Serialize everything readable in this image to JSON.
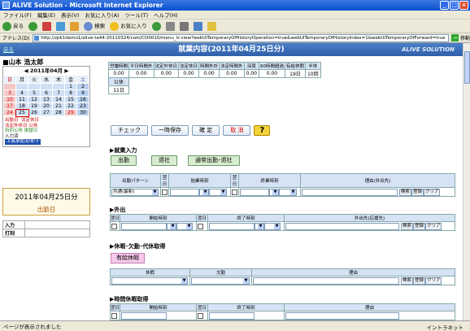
{
  "window": {
    "title": "ALIVE Solution - Microsoft Internet Explorer"
  },
  "menu": [
    "ファイル(F)",
    "編集(E)",
    "表示(V)",
    "お気に入り(A)",
    "ツール(T)",
    "ヘルプ(H)"
  ],
  "toolbar": {
    "back": "戻る",
    "search": "検索",
    "favorites": "お気に入り"
  },
  "address": {
    "label": "アドレス(D)",
    "url": "http://zpk1demo1/alive-ta44-20110324/com/CO0010/menu_tr.view?webUITemporaryOfHistoryOperation=true&webUITemporaryOfHistoryIndex=1&webUITemporaryOfForward=true",
    "go_label": "移動"
  },
  "header": {
    "back_link": "戻る",
    "title": "就業内容(2011年04月25日分)",
    "logo": "ALIVE SOLUTION"
  },
  "user": {
    "name": "山本 浩太郎"
  },
  "calendar": {
    "month": "2011年04月",
    "weekdays": [
      "日",
      "月",
      "火",
      "水",
      "木",
      "金",
      "土"
    ],
    "weeks": [
      [
        "",
        "",
        "",
        "",
        "",
        "1",
        "2"
      ],
      [
        "3",
        "4",
        "5",
        "6",
        "7",
        "8",
        "9"
      ],
      [
        "10",
        "11",
        "12",
        "13",
        "14",
        "15",
        "16"
      ],
      [
        "17",
        "18",
        "19",
        "20",
        "21",
        "22",
        "23"
      ],
      [
        "24",
        "25",
        "26",
        "27",
        "28",
        "29",
        "30"
      ]
    ],
    "legend_l1a": "出勤日",
    "legend_l1b": "法定休日",
    "legend_l2": "法定外休日 公休",
    "legend_l3": "特別公休 振替日",
    "legend_l4": "入力済",
    "legend_badge": "上長承認済/却下"
  },
  "current": {
    "date": "2011年04月25日分",
    "type": "出勤日"
  },
  "inout": {
    "in_label": "入力",
    "out_label": "打刻"
  },
  "summary": {
    "headers": [
      "労働時間",
      "平日時間外",
      "法定外休日",
      "法定休日",
      "時間外計",
      "法定時間外",
      "深夜",
      "60時間超過",
      "有給休暇",
      "半休"
    ],
    "row1": [
      "0.00",
      "0.00",
      "0.00",
      "0.00",
      "0.00",
      "0.00",
      "0.00",
      "0.00",
      "19日",
      "10回"
    ],
    "row2_label": "公休",
    "row3_label": "11日"
  },
  "actions": {
    "check": "チェック",
    "hold": "一時保存",
    "confirm": "確 定",
    "cancel": "取 消",
    "help": "?"
  },
  "work": {
    "title": "▶就業入力",
    "btn_in": "出勤",
    "btn_out": "退社",
    "btn_both": "通常出勤･退社",
    "headers": [
      "出勤パターン",
      "翌日",
      "始業時刻",
      "翌日",
      "終業時刻",
      "理由(外出先)"
    ],
    "pattern_value": "共通(最新)",
    "search": "検索",
    "register": "登録",
    "clear": "クリア"
  },
  "outing": {
    "title": "▶外出",
    "headers": [
      "翌日",
      "開始時刻",
      "翌日",
      "終了時刻",
      "外出先(応援先)"
    ],
    "search": "検索",
    "register": "登録",
    "clear": "クリア"
  },
  "leave": {
    "title": "▶休暇･欠勤･代休取得",
    "paid_btn": "有給休暇",
    "headers": [
      "休暇",
      "欠勤",
      "理由"
    ],
    "search": "検索",
    "register": "登録",
    "clear": "クリア"
  },
  "hourly": {
    "title": "▶時間休暇取得",
    "headers": [
      "翌日",
      "開始時刻",
      "翌日",
      "終了時刻",
      "理由"
    ]
  },
  "status": {
    "left": "ページが表示されました",
    "right": "イントラネット"
  }
}
